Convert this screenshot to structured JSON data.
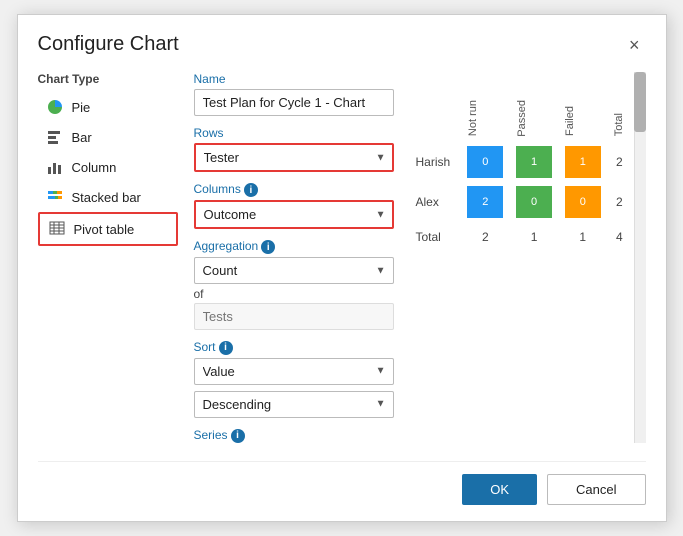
{
  "dialog": {
    "title": "Configure Chart",
    "close_label": "×"
  },
  "chart_type": {
    "label": "Chart Type",
    "items": [
      {
        "id": "pie",
        "label": "Pie",
        "icon": "pie"
      },
      {
        "id": "bar",
        "label": "Bar",
        "icon": "bar"
      },
      {
        "id": "column",
        "label": "Column",
        "icon": "column"
      },
      {
        "id": "stacked_bar",
        "label": "Stacked bar",
        "icon": "stacked_bar"
      },
      {
        "id": "pivot_table",
        "label": "Pivot table",
        "icon": "pivot",
        "selected": true
      }
    ]
  },
  "form": {
    "name_label": "Name",
    "name_value": "Test Plan for Cycle 1 - Chart",
    "rows_label": "Rows",
    "rows_value": "Tester",
    "columns_label": "Columns",
    "columns_value": "Outcome",
    "aggregation_label": "Aggregation",
    "aggregation_value": "Count",
    "of_label": "of",
    "of_placeholder": "Tests",
    "sort_label": "Sort",
    "sort_value": "Value",
    "sort_order_value": "Descending",
    "series_label": "Series"
  },
  "chart": {
    "col_headers": [
      "Not run",
      "Passed",
      "Failed",
      "Total"
    ],
    "rows": [
      {
        "name": "Harish",
        "values": [
          0,
          1,
          1
        ],
        "total": 2,
        "colors": [
          "#2196F3",
          "#4CAF50",
          "#FF9800"
        ]
      },
      {
        "name": "Alex",
        "values": [
          2,
          0,
          0
        ],
        "total": 2,
        "colors": [
          "#2196F3",
          "#4CAF50",
          "#FF9800"
        ]
      }
    ],
    "totals": {
      "label": "Total",
      "values": [
        2,
        1,
        1,
        4
      ]
    }
  },
  "footer": {
    "ok_label": "OK",
    "cancel_label": "Cancel"
  }
}
